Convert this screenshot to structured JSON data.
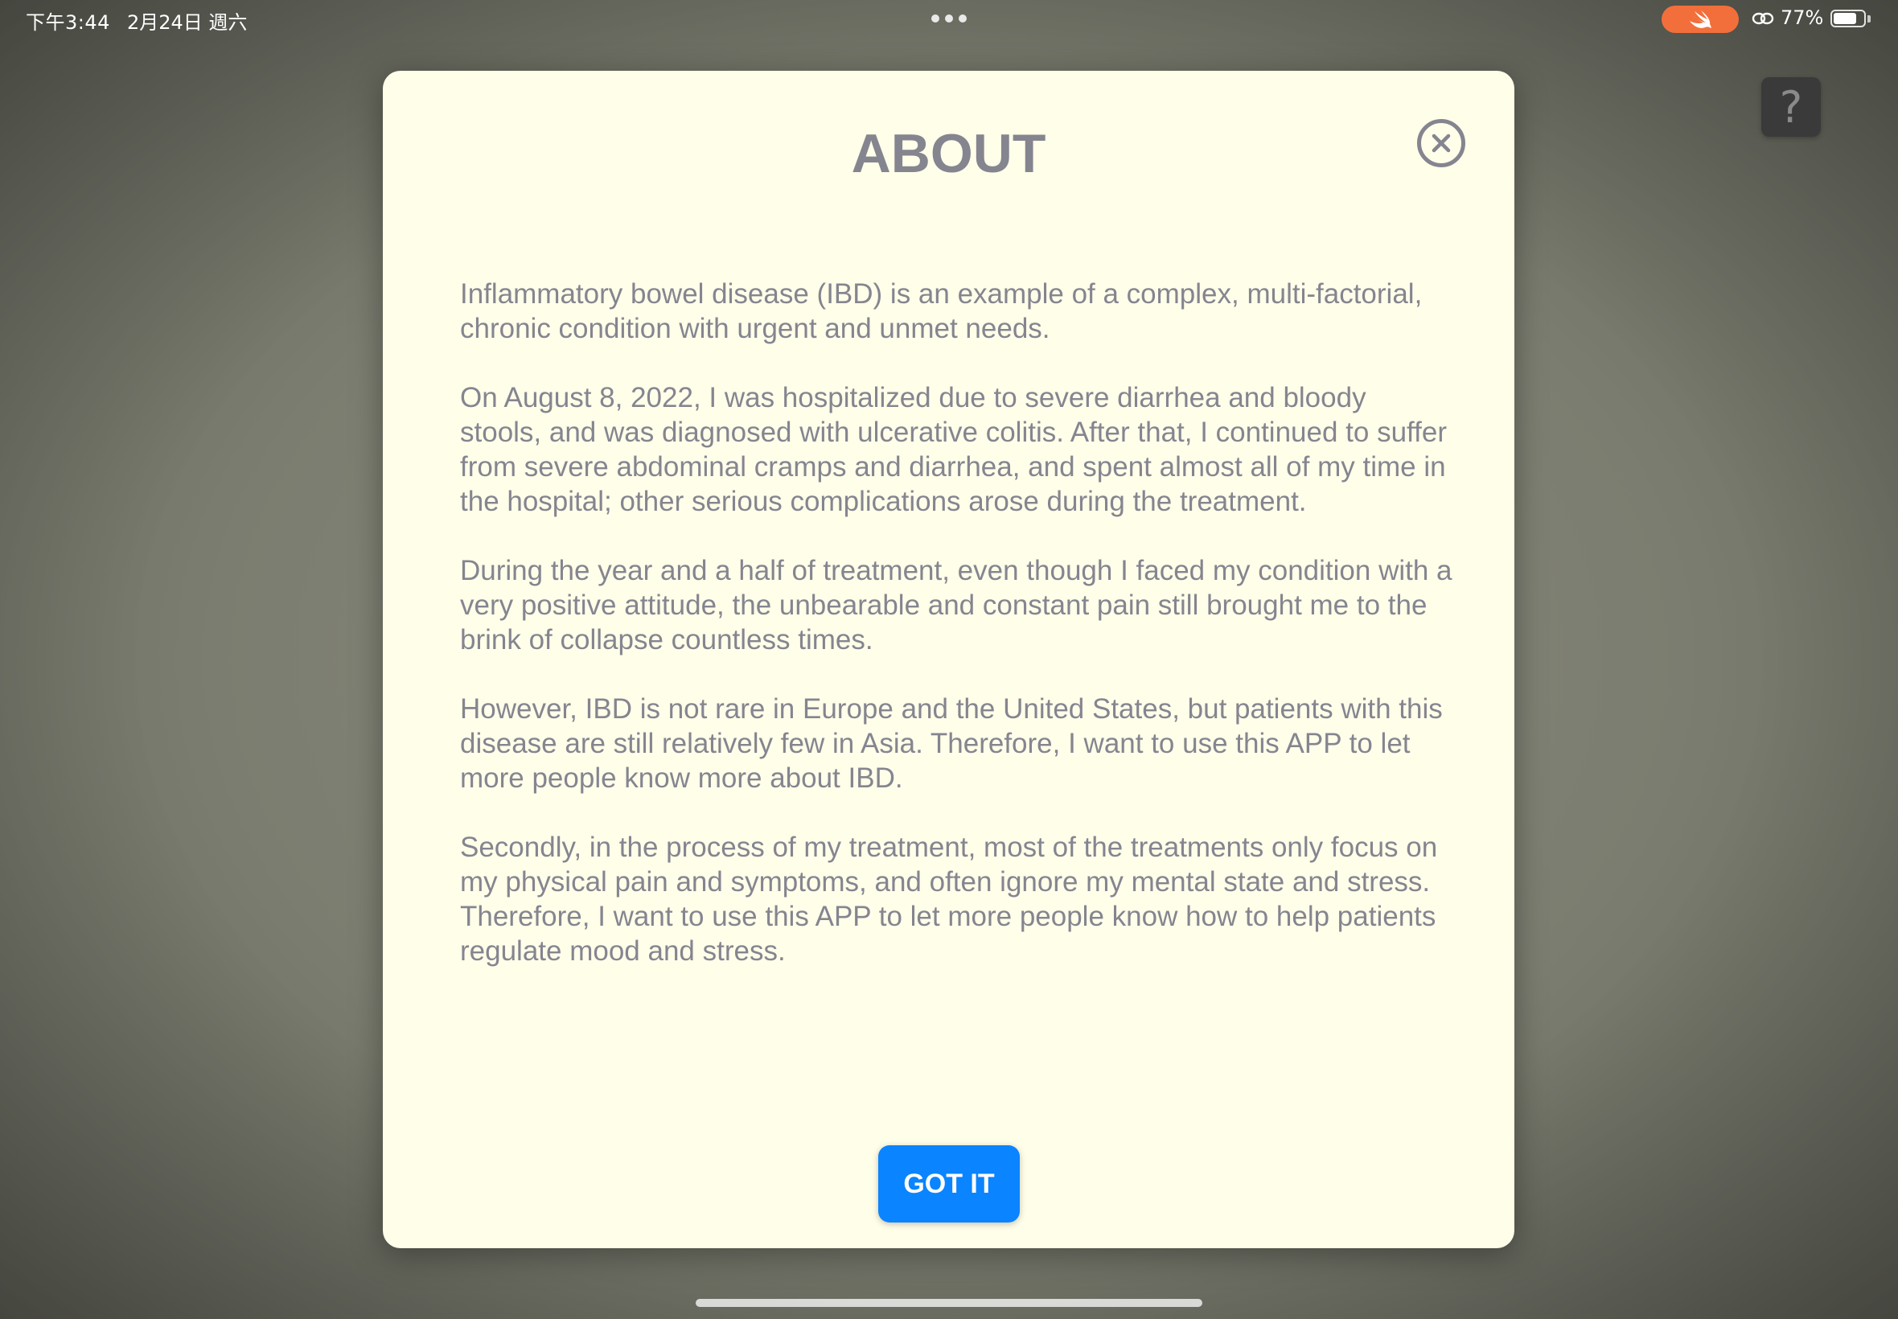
{
  "status_bar": {
    "time": "下午3:44",
    "date": "2月24日 週六",
    "battery_percent": "77%",
    "battery_level": 0.77
  },
  "background": {
    "help_button_label": "?"
  },
  "modal": {
    "title": "ABOUT",
    "paragraphs": [
      "Inflammatory bowel disease (IBD) is an example of a complex, multi-factorial, chronic condition with urgent and unmet needs.",
      "On August 8, 2022, I was hospitalized due to severe diarrhea and bloody stools, and was diagnosed with ulcerative colitis. After that, I continued to suffer from severe abdominal cramps and diarrhea, and spent almost all of my time in the hospital; other serious complications arose during the treatment.",
      "During the year and a half of treatment, even though I faced my condition with a very positive attitude, the unbearable and constant pain still brought me to the brink of collapse countless times.",
      "However, IBD is not rare in Europe and the United States, but patients with this disease are still relatively few in Asia. Therefore, I want to use this APP to let more people know more about IBD.",
      "Secondly, in the process of my treatment, most of the treatments only focus on my physical pain and symptoms, and often ignore my mental state and stress. Therefore, I want to use this APP to let more people know how to help patients regulate mood and stress."
    ],
    "button_label": "GOT IT"
  },
  "icons": {
    "close": "close-circle-icon",
    "help": "question-mark-icon",
    "swift": "swift-icon",
    "link": "link-icon",
    "battery": "battery-icon"
  },
  "colors": {
    "modal_background": "#fffee9",
    "text": "#858590",
    "button": "#0a84ff",
    "swift_pill": "#f26f3b"
  }
}
